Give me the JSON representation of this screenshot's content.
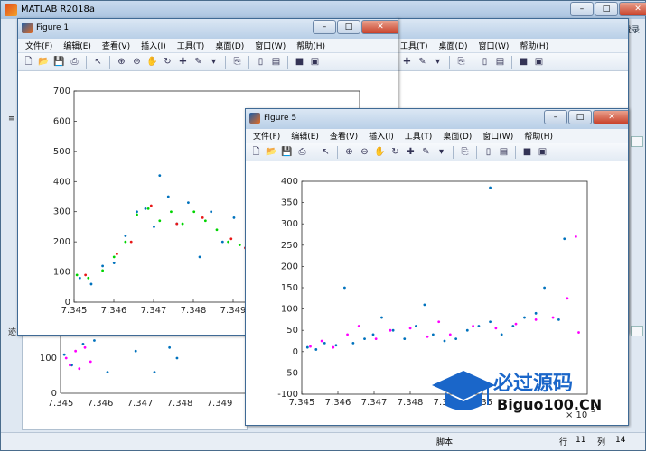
{
  "main_window": {
    "title": "MATLAB R2018a",
    "left_text_1": "≡",
    "left_text_2": "迹",
    "right_login": "登录",
    "status": {
      "script": "脚本",
      "row_label": "行",
      "row": "11",
      "col_label": "列",
      "col": "14"
    }
  },
  "menu": [
    "文件(F)",
    "编辑(E)",
    "查看(V)",
    "插入(I)",
    "工具(T)",
    "桌面(D)",
    "窗口(W)",
    "帮助(H)"
  ],
  "toolbar_icons": [
    "new-icon",
    "open-icon",
    "save-icon",
    "print-icon",
    "|",
    "pointer-icon",
    "|",
    "zoom-in-icon",
    "zoom-out-icon",
    "pan-icon",
    "rotate-icon",
    "data-cursor-icon",
    "brush-icon",
    "dropdown-icon",
    "|",
    "link-icon",
    "|",
    "colorbar-icon",
    "legend-icon",
    "|",
    "hide-icon",
    "show-icon"
  ],
  "fig1": {
    "title": "Figure 1",
    "chart_data": {
      "type": "scatter",
      "xlabel": "",
      "ylabel": "",
      "xticks": [
        "7.345",
        "7.346",
        "7.347",
        "7.348",
        "7.349"
      ],
      "yticks": [
        "0",
        "100",
        "200",
        "300",
        "400",
        "500",
        "600",
        "700"
      ],
      "ylim": [
        0,
        700
      ],
      "series": [
        {
          "color": "#0072bd",
          "values": [
            [
              0.02,
              80
            ],
            [
              0.06,
              60
            ],
            [
              0.1,
              120
            ],
            [
              0.14,
              130
            ],
            [
              0.18,
              220
            ],
            [
              0.22,
              300
            ],
            [
              0.25,
              310
            ],
            [
              0.28,
              250
            ],
            [
              0.3,
              420
            ],
            [
              0.33,
              350
            ],
            [
              0.36,
              260
            ],
            [
              0.4,
              330
            ],
            [
              0.44,
              150
            ],
            [
              0.48,
              300
            ],
            [
              0.52,
              200
            ],
            [
              0.56,
              280
            ],
            [
              0.6,
              180
            ],
            [
              0.63,
              230
            ],
            [
              0.66,
              300
            ],
            [
              0.7,
              380
            ],
            [
              0.74,
              360
            ],
            [
              0.78,
              420
            ],
            [
              0.82,
              380
            ],
            [
              0.86,
              400
            ],
            [
              0.88,
              520
            ]
          ]
        },
        {
          "color": "#00d400",
          "values": [
            [
              0.01,
              90
            ],
            [
              0.05,
              80
            ],
            [
              0.1,
              105
            ],
            [
              0.14,
              150
            ],
            [
              0.18,
              200
            ],
            [
              0.22,
              290
            ],
            [
              0.26,
              310
            ],
            [
              0.3,
              270
            ],
            [
              0.34,
              300
            ],
            [
              0.38,
              260
            ],
            [
              0.42,
              300
            ],
            [
              0.46,
              270
            ],
            [
              0.5,
              240
            ],
            [
              0.54,
              200
            ],
            [
              0.58,
              190
            ],
            [
              0.62,
              220
            ],
            [
              0.66,
              260
            ],
            [
              0.7,
              340
            ],
            [
              0.74,
              380
            ],
            [
              0.78,
              390
            ],
            [
              0.82,
              370
            ],
            [
              0.86,
              390
            ]
          ]
        },
        {
          "color": "#e81818",
          "values": [
            [
              0.04,
              90
            ],
            [
              0.15,
              160
            ],
            [
              0.2,
              200
            ],
            [
              0.27,
              320
            ],
            [
              0.36,
              260
            ],
            [
              0.45,
              280
            ],
            [
              0.55,
              210
            ],
            [
              0.6,
              180
            ],
            [
              0.72,
              370
            ],
            [
              0.8,
              400
            ]
          ]
        }
      ]
    }
  },
  "fig_bg": {
    "chart_data": {
      "type": "scatter",
      "xticks": [
        "7.345",
        "7.346",
        "7.347",
        "7.348",
        "7.349"
      ],
      "yticks": [
        "0",
        "100"
      ],
      "series": [
        {
          "color": "#0072bd",
          "values": [
            [
              0.02,
              110
            ],
            [
              0.06,
              80
            ],
            [
              0.12,
              140
            ],
            [
              0.18,
              150
            ],
            [
              0.25,
              60
            ],
            [
              0.4,
              120
            ],
            [
              0.5,
              60
            ],
            [
              0.58,
              130
            ],
            [
              0.62,
              100
            ]
          ]
        },
        {
          "color": "#ff00ff",
          "values": [
            [
              0.03,
              100
            ],
            [
              0.05,
              80
            ],
            [
              0.08,
              120
            ],
            [
              0.1,
              70
            ],
            [
              0.13,
              130
            ],
            [
              0.16,
              90
            ]
          ]
        }
      ]
    }
  },
  "fig5": {
    "title": "Figure 5",
    "chart_data": {
      "type": "scatter",
      "xlabel": "",
      "ylabel": "",
      "xticks": [
        "7.345",
        "7.346",
        "7.347",
        "7.348",
        "7.349",
        "7.35"
      ],
      "yticks": [
        "-100",
        "-50",
        "0",
        "50",
        "100",
        "150",
        "200",
        "250",
        "300",
        "350",
        "400"
      ],
      "ylim": [
        -100,
        400
      ],
      "exponent_label": "× 10",
      "exponent_power": "5",
      "series": [
        {
          "color": "#0072bd",
          "values": [
            [
              0.02,
              10
            ],
            [
              0.05,
              5
            ],
            [
              0.08,
              20
            ],
            [
              0.12,
              15
            ],
            [
              0.15,
              150
            ],
            [
              0.18,
              20
            ],
            [
              0.22,
              30
            ],
            [
              0.25,
              40
            ],
            [
              0.28,
              80
            ],
            [
              0.32,
              50
            ],
            [
              0.36,
              30
            ],
            [
              0.4,
              60
            ],
            [
              0.43,
              110
            ],
            [
              0.46,
              40
            ],
            [
              0.5,
              25
            ],
            [
              0.54,
              30
            ],
            [
              0.58,
              50
            ],
            [
              0.62,
              60
            ],
            [
              0.66,
              70
            ],
            [
              0.7,
              40
            ],
            [
              0.74,
              60
            ],
            [
              0.78,
              80
            ],
            [
              0.82,
              90
            ],
            [
              0.85,
              150
            ],
            [
              0.9,
              75
            ],
            [
              0.92,
              265
            ],
            [
              0.66,
              385
            ]
          ]
        },
        {
          "color": "#ff00ff",
          "values": [
            [
              0.03,
              12
            ],
            [
              0.07,
              25
            ],
            [
              0.11,
              10
            ],
            [
              0.16,
              40
            ],
            [
              0.2,
              60
            ],
            [
              0.26,
              30
            ],
            [
              0.31,
              50
            ],
            [
              0.38,
              55
            ],
            [
              0.44,
              35
            ],
            [
              0.48,
              70
            ],
            [
              0.52,
              40
            ],
            [
              0.6,
              60
            ],
            [
              0.68,
              55
            ],
            [
              0.75,
              65
            ],
            [
              0.82,
              75
            ],
            [
              0.88,
              80
            ],
            [
              0.93,
              125
            ],
            [
              0.96,
              270
            ],
            [
              0.97,
              45
            ]
          ]
        }
      ]
    }
  },
  "watermark": {
    "brand": "必过源码",
    "url": "Biguo100.CN"
  }
}
